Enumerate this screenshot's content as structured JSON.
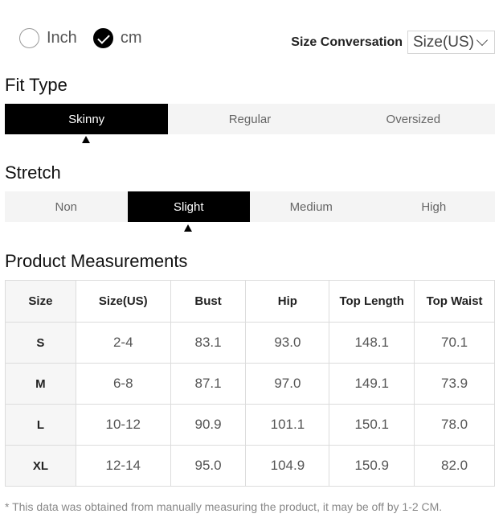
{
  "units": {
    "options": [
      {
        "label": "Inch",
        "checked": false
      },
      {
        "label": "cm",
        "checked": true
      }
    ]
  },
  "size_conversion": {
    "label": "Size Conversation",
    "selected": "Size(US)"
  },
  "fit_type": {
    "title": "Fit Type",
    "options": [
      "Skinny",
      "Regular",
      "Oversized"
    ],
    "active_index": 0
  },
  "stretch": {
    "title": "Stretch",
    "options": [
      "Non",
      "Slight",
      "Medium",
      "High"
    ],
    "active_index": 1
  },
  "measurements": {
    "title": "Product Measurements",
    "headers": [
      "Size",
      "Size(US)",
      "Bust",
      "Hip",
      "Top Length",
      "Top Waist"
    ],
    "rows": [
      [
        "S",
        "2-4",
        "83.1",
        "93.0",
        "148.1",
        "70.1"
      ],
      [
        "M",
        "6-8",
        "87.1",
        "97.0",
        "149.1",
        "73.9"
      ],
      [
        "L",
        "10-12",
        "90.9",
        "101.1",
        "150.1",
        "78.0"
      ],
      [
        "XL",
        "12-14",
        "95.0",
        "104.9",
        "150.9",
        "82.0"
      ]
    ]
  },
  "note": "* This data was obtained from manually measuring the product, it may be off by 1-2 CM."
}
